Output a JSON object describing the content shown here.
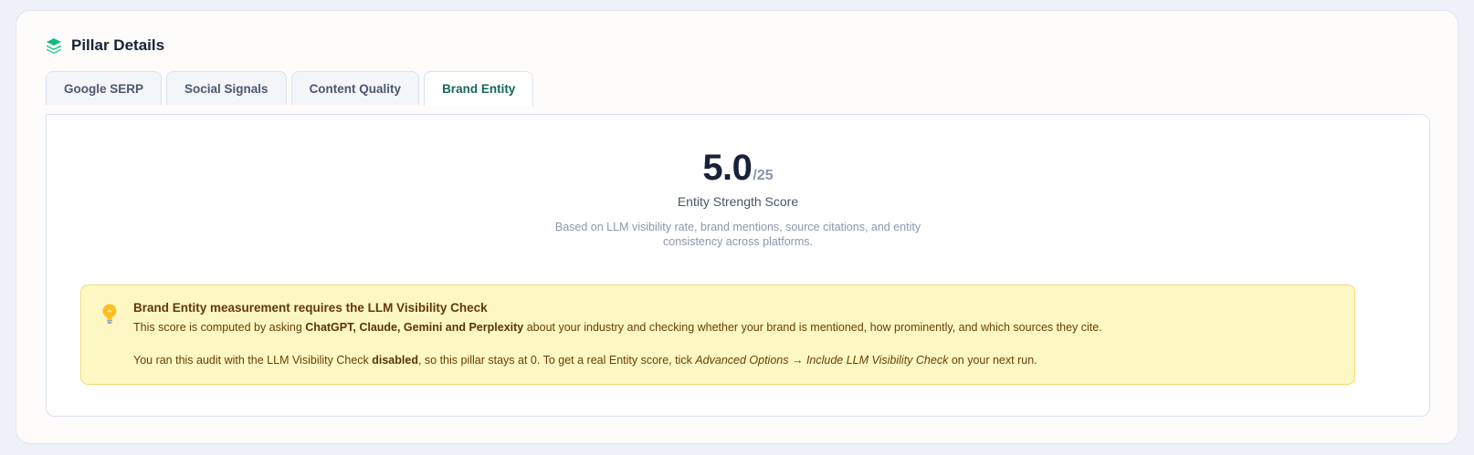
{
  "card": {
    "title": "Pillar Details",
    "icon": "layers-icon"
  },
  "tabs": [
    {
      "label": "Google SERP",
      "active": false
    },
    {
      "label": "Social Signals",
      "active": false
    },
    {
      "label": "Content Quality",
      "active": false
    },
    {
      "label": "Brand Entity",
      "active": true
    }
  ],
  "score": {
    "value": "5.0",
    "max": "/25",
    "label": "Entity Strength Score",
    "description": "Based on LLM visibility rate, brand mentions, source citations, and entity consistency across platforms."
  },
  "notice": {
    "icon": "lightbulb-icon",
    "title": "Brand Entity measurement requires the LLM Visibility Check",
    "p1_pre": "This score is computed by asking ",
    "p1_bold": "ChatGPT, Claude, Gemini and Perplexity",
    "p1_post": " about your industry and checking whether your brand is mentioned, how prominently, and which sources they cite.",
    "p2_pre": "You ran this audit with the LLM Visibility Check ",
    "p2_bold": "disabled",
    "p2_mid": ", so this pillar stays at 0. To get a real Entity score, tick ",
    "p2_italic": "Advanced Options → Include LLM Visibility Check",
    "p2_post": " on your next run."
  },
  "colors": {
    "accent": "#17675a",
    "icon_green": "#10b981",
    "notice_bg": "#fdf7c3",
    "notice_border": "#f0dd79",
    "notice_text": "#6b3d06"
  }
}
